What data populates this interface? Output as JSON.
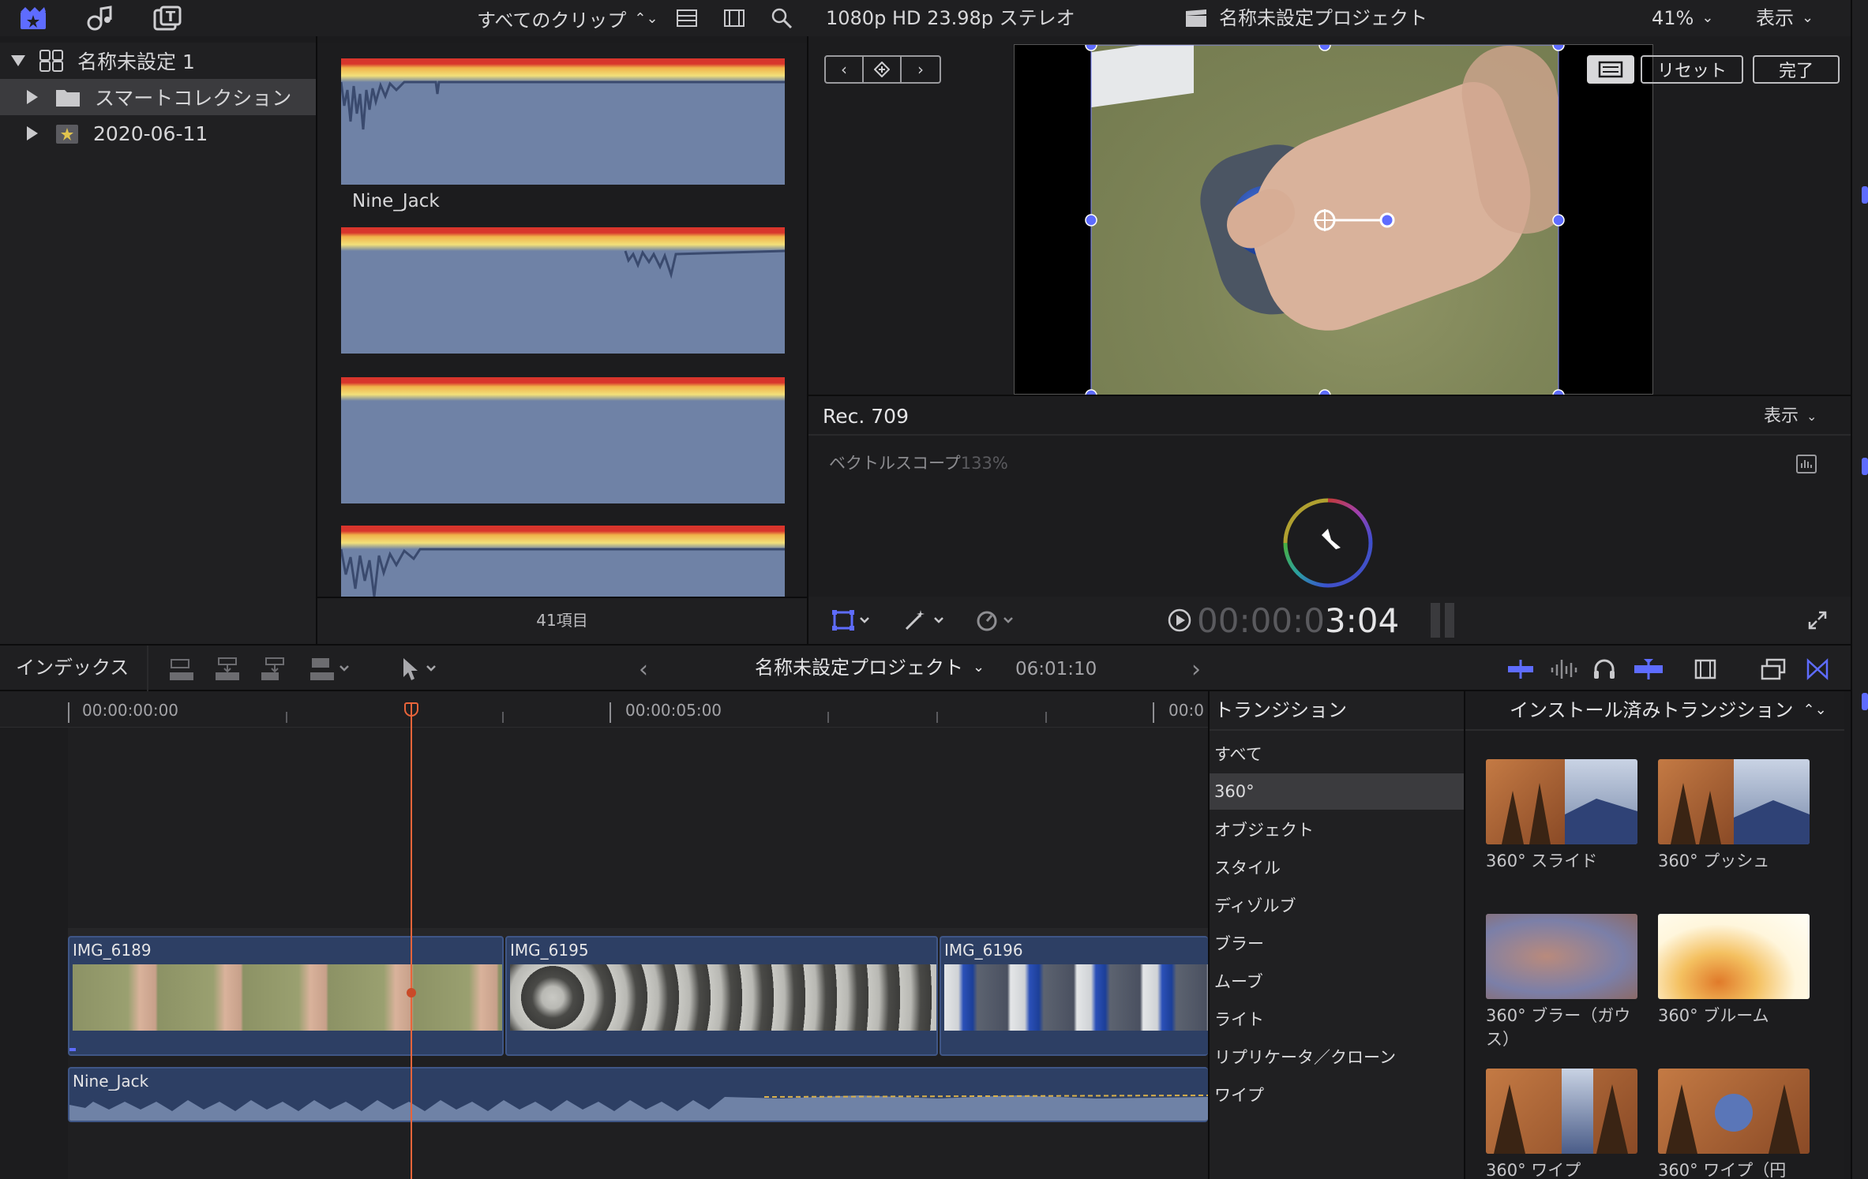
{
  "toolbar": {
    "clip_filter": "すべてのクリップ",
    "format": "1080p HD 23.98p ステレオ",
    "project_title": "名称未設定プロジェクト",
    "zoom": "41%",
    "view_menu": "表示"
  },
  "library": {
    "items": [
      {
        "label": "名称未設定 1"
      },
      {
        "label": "スマートコレクション"
      },
      {
        "label": "2020-06-11"
      }
    ]
  },
  "browser": {
    "clip_name": "Nine_Jack",
    "item_count": "41項目"
  },
  "viewer": {
    "reset_label": "リセット",
    "done_label": "完了",
    "timecode_dim": "00:00:0",
    "timecode_bright": "3:04"
  },
  "scope": {
    "color_space": "Rec. 709",
    "view_menu": "表示",
    "label": "ベクトルスコープ",
    "percent": "133%"
  },
  "timeline_bar": {
    "index_label": "インデックス",
    "project_name": "名称未設定プロジェクト",
    "duration": "06:01:10"
  },
  "ruler": {
    "tc_start": "00:00:00:00",
    "tc_mid": "00:00:05:00",
    "tc_end": "00:0"
  },
  "clips": [
    {
      "name": "IMG_6189"
    },
    {
      "name": "IMG_6195"
    },
    {
      "name": "IMG_6196"
    }
  ],
  "audio_clip": {
    "name": "Nine_Jack"
  },
  "transitions": {
    "header": "トランジション",
    "installed_header": "インストール済みトランジション",
    "categories": [
      {
        "label": "すべて"
      },
      {
        "label": "360°"
      },
      {
        "label": "オブジェクト"
      },
      {
        "label": "スタイル"
      },
      {
        "label": "ディゾルブ"
      },
      {
        "label": "ブラー"
      },
      {
        "label": "ムーブ"
      },
      {
        "label": "ライト"
      },
      {
        "label": "リプリケータ／クローン"
      },
      {
        "label": "ワイプ"
      }
    ],
    "items": [
      {
        "label": "360° スライド"
      },
      {
        "label": "360° プッシュ"
      },
      {
        "label": "360° ブラー（ガウス）"
      },
      {
        "label": "360° ブルーム"
      },
      {
        "label": "360° ワイプ"
      },
      {
        "label": "360° ワイプ（円"
      }
    ]
  },
  "colors": {
    "accent": "#5e6cff",
    "playhead": "#e8643a",
    "clip_bg": "#2d3f64",
    "audio_wave": "#6f82a6"
  }
}
